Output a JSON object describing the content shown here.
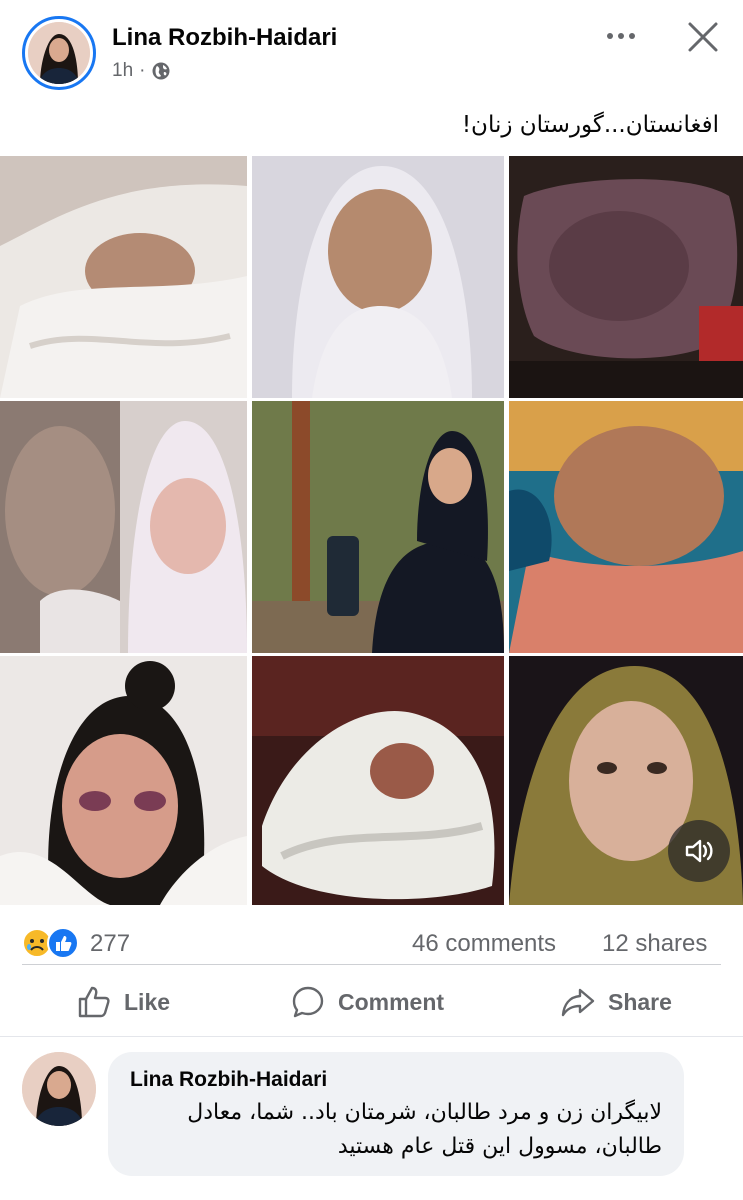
{
  "post": {
    "author": "Lina Rozbih-Haidari",
    "time": "1h",
    "separator": "·",
    "text": "افغانستان...گورستان زنان!"
  },
  "icons": {
    "more": "more-options-icon",
    "close": "close-icon",
    "privacy": "globe-icon",
    "sound": "speaker-icon",
    "like": "thumbs-up-icon",
    "comment": "comment-bubble-icon",
    "share": "share-arrow-icon",
    "reactions": [
      "sad-reaction-icon",
      "like-reaction-icon"
    ]
  },
  "photos": [
    "photo-1",
    "photo-2",
    "photo-3",
    "photo-4",
    "photo-5",
    "photo-6",
    "photo-7",
    "photo-8",
    "photo-9"
  ],
  "stats": {
    "reactions": "277",
    "comments": "46 comments",
    "shares": "12 shares"
  },
  "actions": {
    "like": "Like",
    "comment": "Comment",
    "share": "Share"
  },
  "comment": {
    "author": "Lina Rozbih-Haidari",
    "text": "لابیگران زن و مرد طالبان، شرمتان باد.. شما، معادل طالبان، مسوول این قتل عام هستید"
  },
  "colors": {
    "accent": "#1877f2",
    "secondary_text": "#65676b",
    "bubble": "#f0f2f5"
  }
}
